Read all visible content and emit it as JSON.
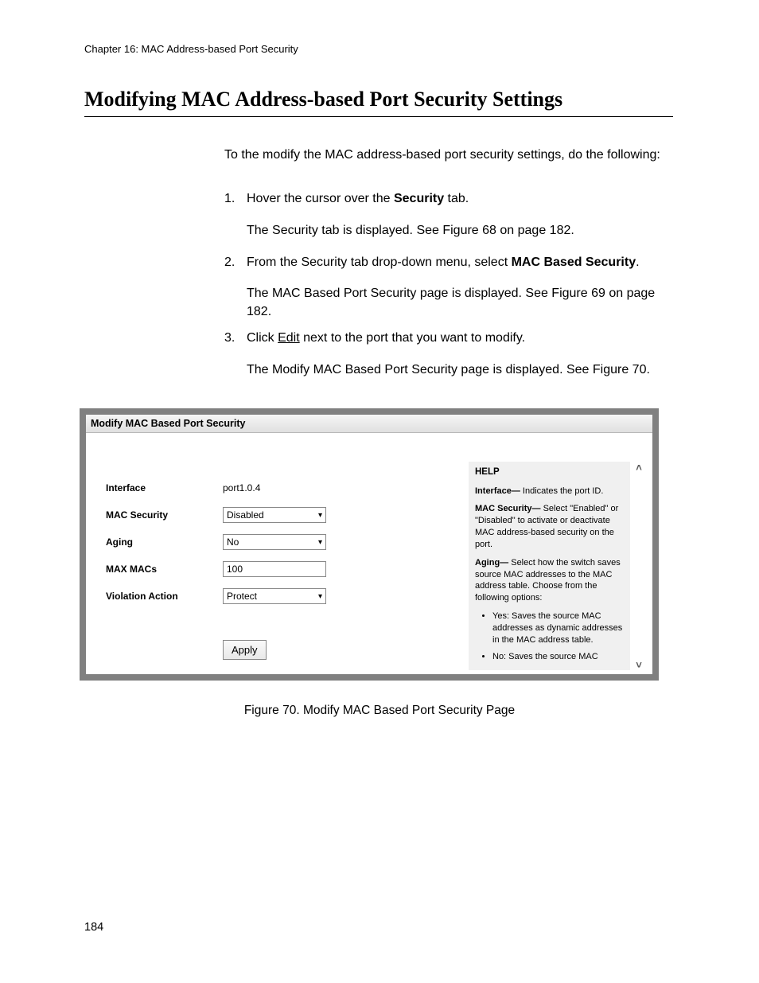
{
  "chapter_header": "Chapter 16: MAC Address-based Port Security",
  "section_title": "Modifying MAC Address-based Port Security Settings",
  "intro": "To the modify the MAC address-based port security settings, do the following:",
  "steps": {
    "s1_num": "1.",
    "s1_pre": "Hover the cursor over the ",
    "s1_bold": "Security",
    "s1_post": " tab.",
    "s1_sub": "The Security tab is displayed. See Figure 68 on page 182.",
    "s2_num": "2.",
    "s2_pre": "From the Security tab drop-down menu, select ",
    "s2_bold": "MAC Based Security",
    "s2_post": ".",
    "s2_sub": "The MAC Based Port Security page is displayed. See Figure 69 on page 182.",
    "s3_num": "3.",
    "s3_pre": "Click ",
    "s3_link": "Edit",
    "s3_post": " next to the port that you want to modify.",
    "s3_sub": "The Modify MAC Based Port Security page is displayed. See Figure 70."
  },
  "figure": {
    "titlebar": "Modify MAC Based Port Security",
    "labels": {
      "interface": "Interface",
      "mac_security": "MAC Security",
      "aging": "Aging",
      "max_macs": "MAX MACs",
      "violation": "Violation Action"
    },
    "values": {
      "interface": "port1.0.4",
      "mac_security": "Disabled",
      "aging": "No",
      "max_macs": "100",
      "violation": "Protect"
    },
    "apply": "Apply",
    "help": {
      "title": "HELP",
      "p1_b": "Interface—",
      "p1": " Indicates the port ID.",
      "p2_b": "MAC Security—",
      "p2": " Select \"Enabled\" or \"Disabled\" to activate or deactivate MAC address-based security on the port.",
      "p3_b": "Aging—",
      "p3": " Select how the switch saves source MAC addresses to the MAC address table. Choose from the following options:",
      "li1": "Yes: Saves the source MAC addresses as dynamic addresses in the MAC address table.",
      "li2": "No: Saves the source MAC"
    }
  },
  "figure_caption": "Figure 70. Modify MAC Based Port Security Page",
  "page_number": "184"
}
